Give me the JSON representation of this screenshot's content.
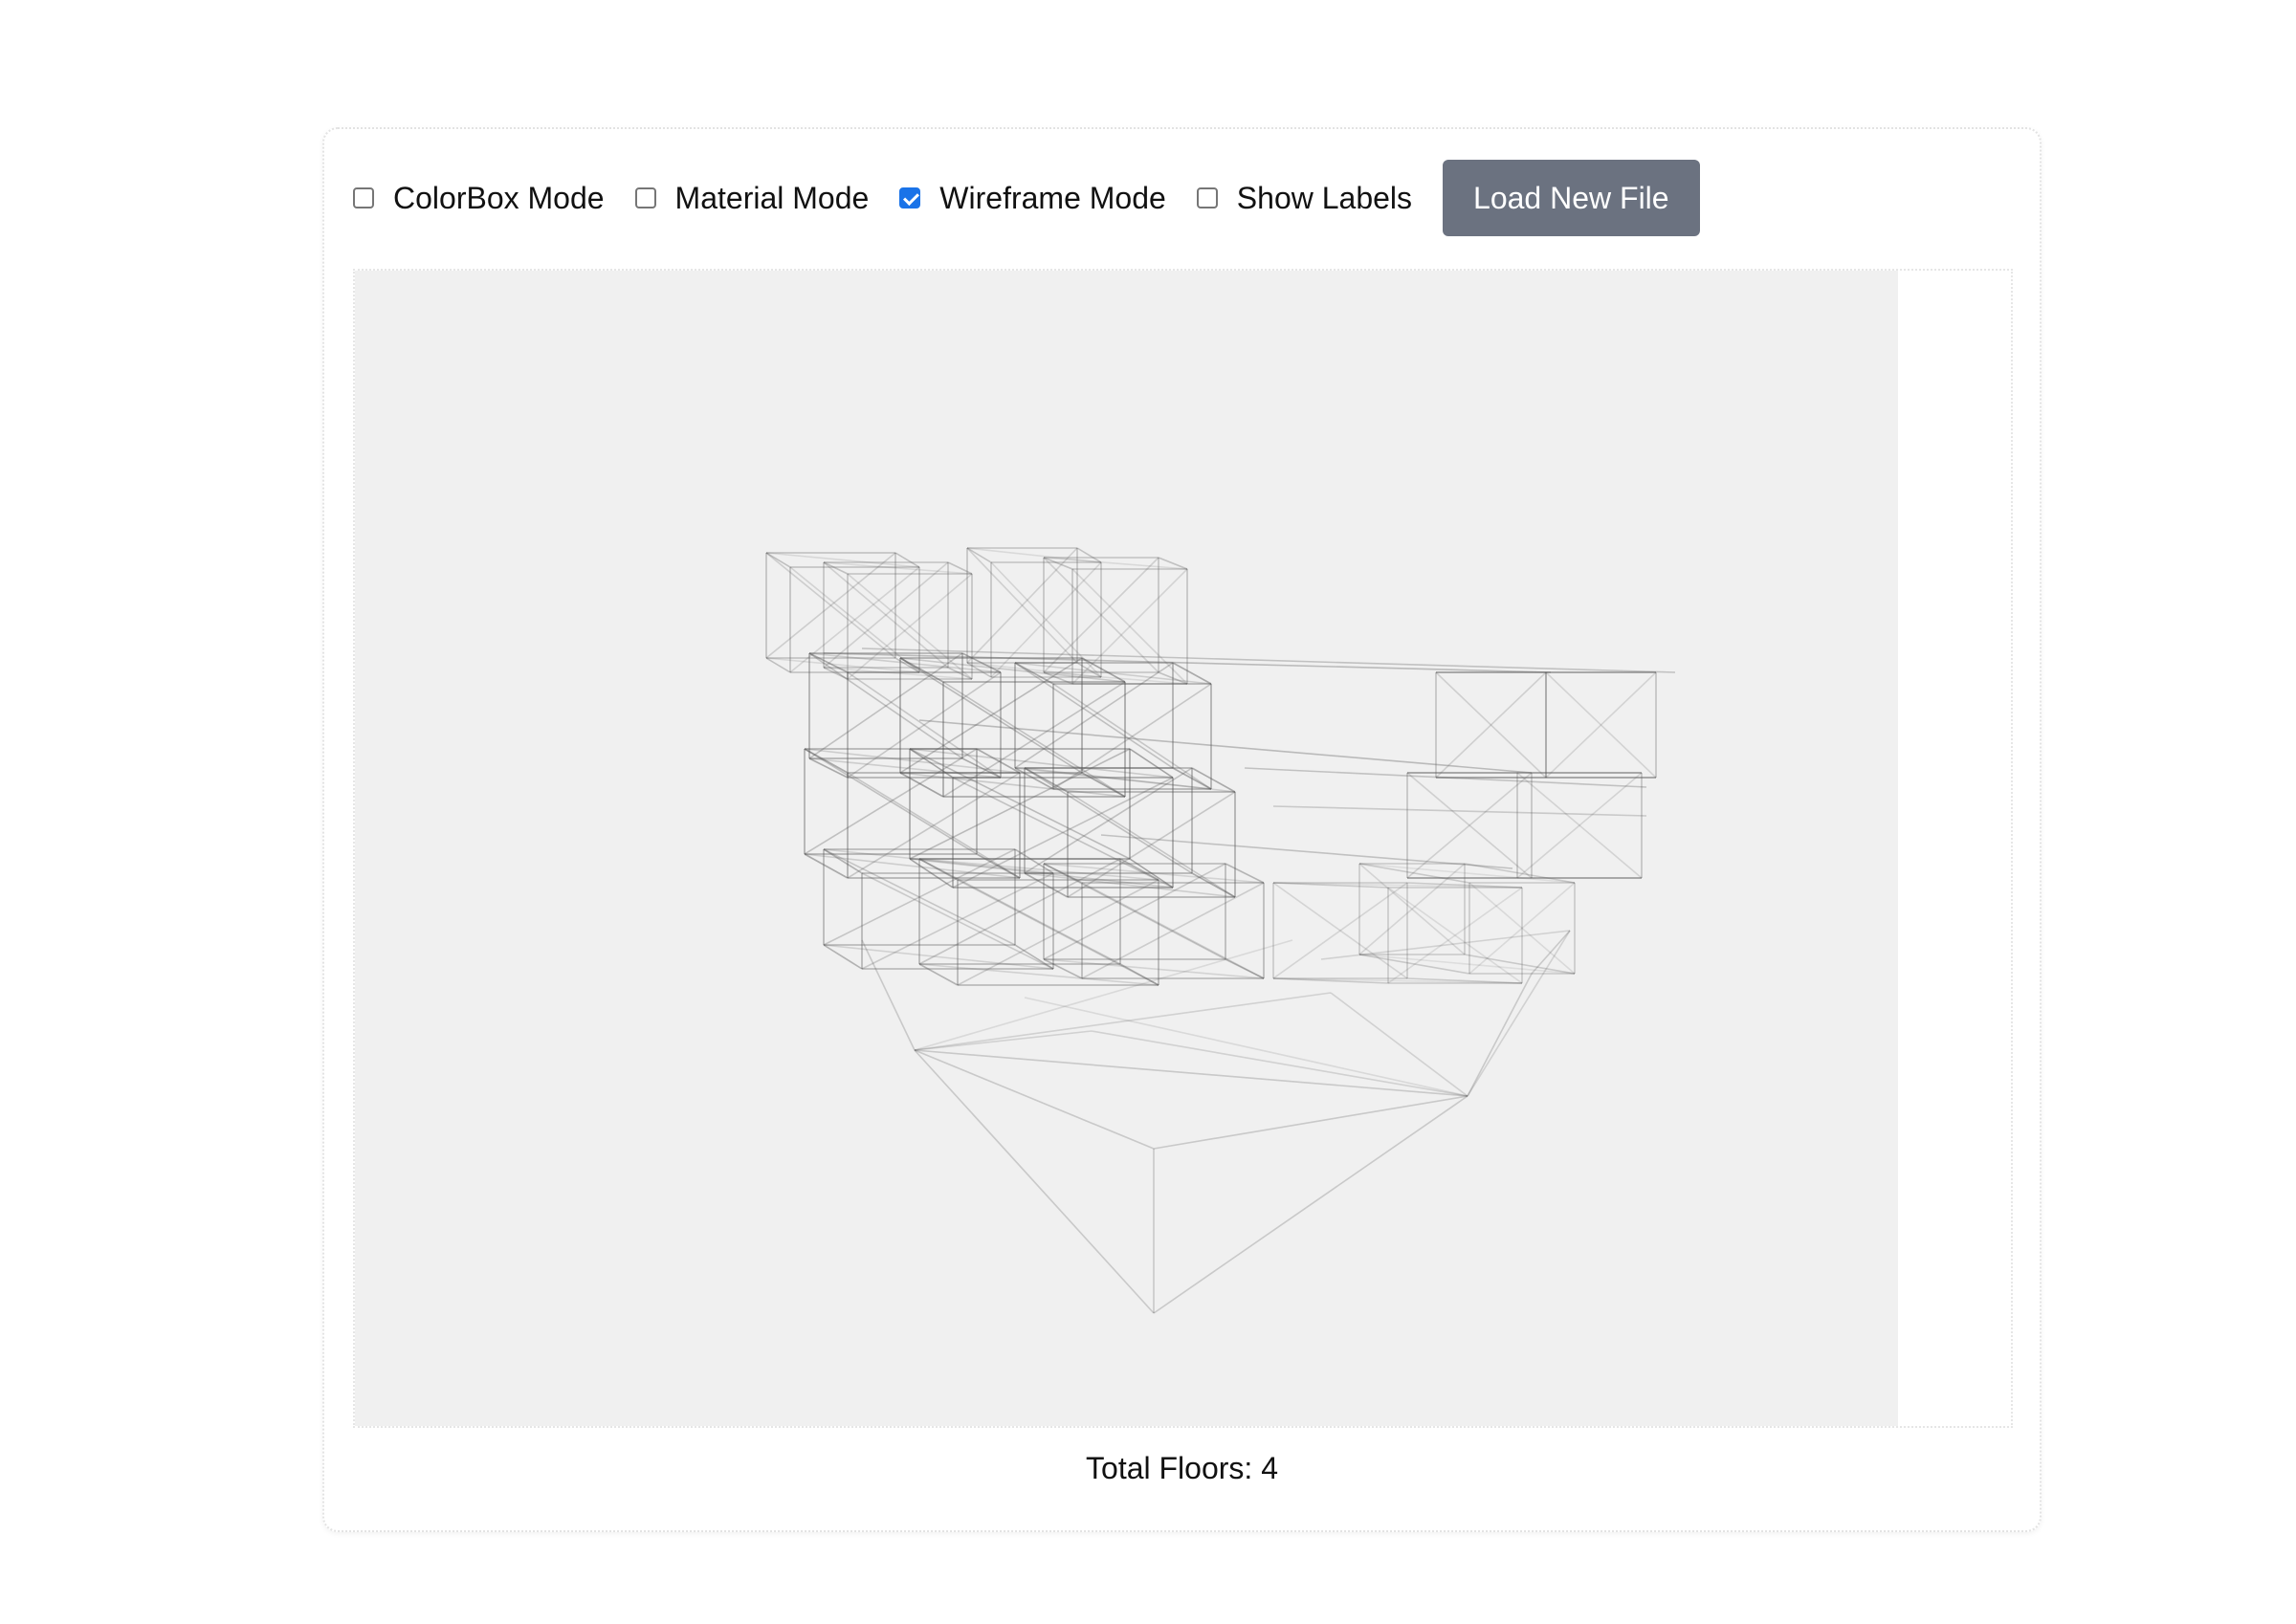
{
  "toolbar": {
    "toggles": [
      {
        "label": "ColorBox Mode",
        "checked": false
      },
      {
        "label": "Material Mode",
        "checked": false
      },
      {
        "label": "Wireframe Mode",
        "checked": true
      },
      {
        "label": "Show Labels",
        "checked": false
      }
    ],
    "load_button_label": "Load New File"
  },
  "viewport": {
    "background_color": "#f0f0f0",
    "wireframe_color": "#555555"
  },
  "footer": {
    "total_floors_text": "Total Floors: 4"
  },
  "colors": {
    "accent": "#1a73e8",
    "button_bg": "#6b7280"
  }
}
